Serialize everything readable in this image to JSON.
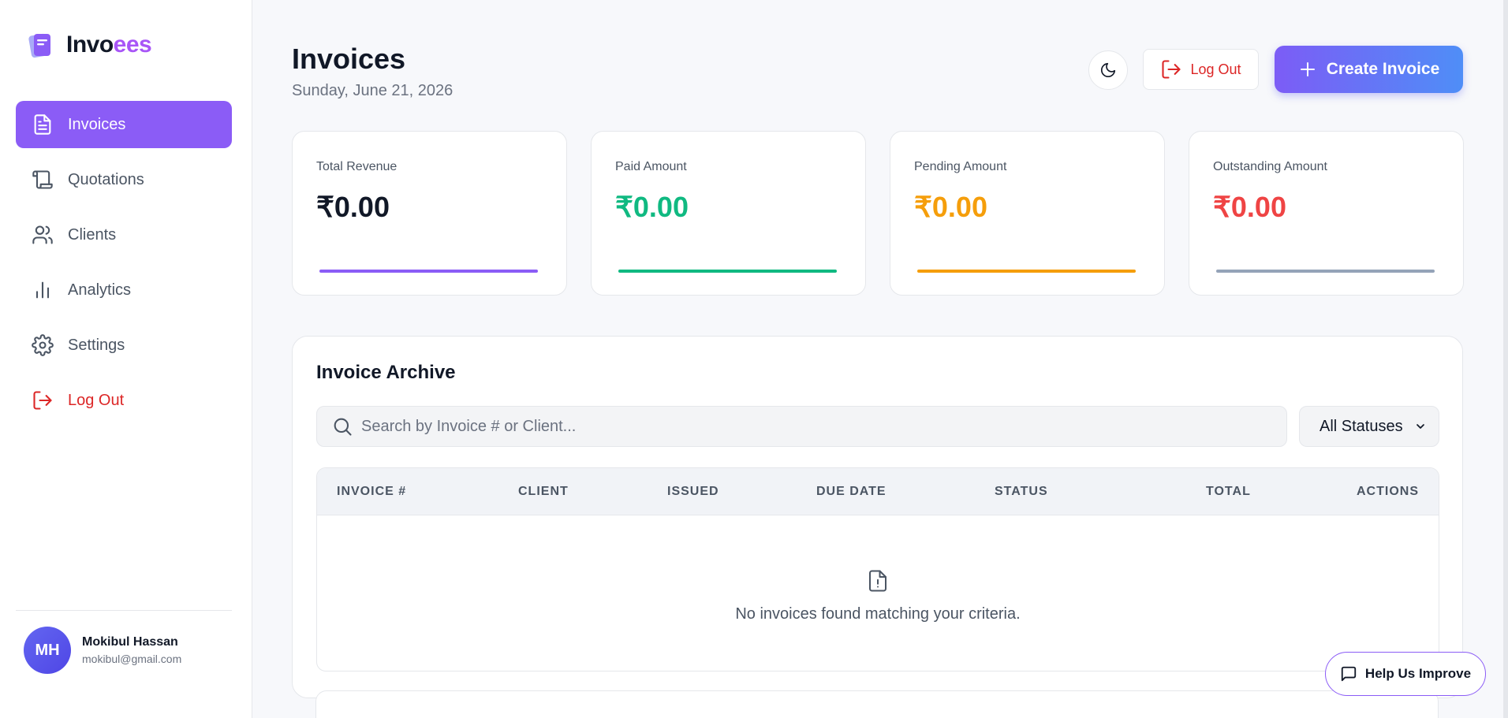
{
  "brand": {
    "name_part1": "Invo",
    "name_part2": "ees"
  },
  "sidebar": {
    "items": [
      {
        "label": "Invoices",
        "icon": "file-text-icon"
      },
      {
        "label": "Quotations",
        "icon": "scroll-icon"
      },
      {
        "label": "Clients",
        "icon": "users-icon"
      },
      {
        "label": "Analytics",
        "icon": "bar-chart-icon"
      },
      {
        "label": "Settings",
        "icon": "gear-icon"
      },
      {
        "label": "Log Out",
        "icon": "logout-icon"
      }
    ],
    "user": {
      "initials": "MH",
      "name": "Mokibul Hassan",
      "email": "mokibul@gmail.com"
    }
  },
  "header": {
    "title": "Invoices",
    "date": "Sunday, June 21, 2026",
    "logout_label": "Log Out",
    "create_label": "Create Invoice"
  },
  "stats": [
    {
      "label": "Total Revenue",
      "value": "₹0.00",
      "color": "#111827",
      "bar_color": "#8b5cf6"
    },
    {
      "label": "Paid Amount",
      "value": "₹0.00",
      "color": "#10b981",
      "bar_color": "#10b981"
    },
    {
      "label": "Pending Amount",
      "value": "₹0.00",
      "color": "#f59e0b",
      "bar_color": "#f59e0b"
    },
    {
      "label": "Outstanding Amount",
      "value": "₹0.00",
      "color": "#ef4444",
      "bar_color": "#94a3b8"
    }
  ],
  "archive": {
    "title": "Invoice Archive",
    "search_placeholder": "Search by Invoice # or Client...",
    "status_filter": "All Statuses",
    "columns": [
      "INVOICE #",
      "CLIENT",
      "ISSUED",
      "DUE DATE",
      "STATUS",
      "TOTAL",
      "ACTIONS"
    ],
    "empty_message": "No invoices found matching your criteria."
  },
  "help_label": "Help Us Improve"
}
